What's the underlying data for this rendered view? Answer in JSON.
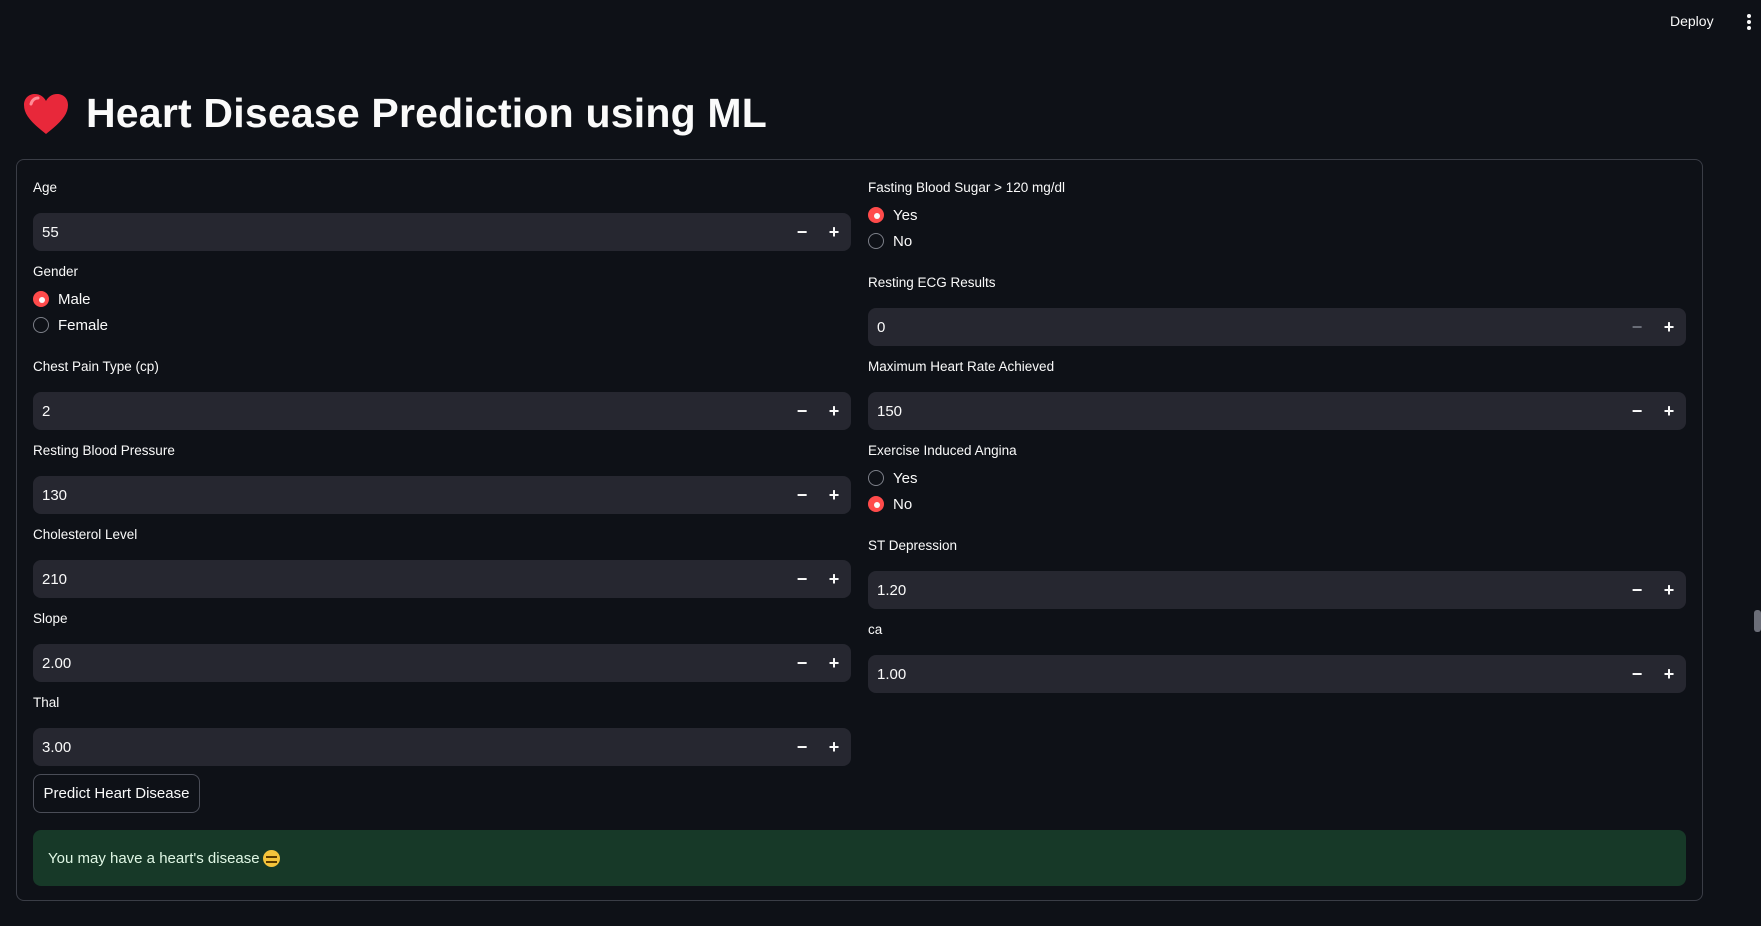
{
  "header": {
    "deploy_label": "Deploy"
  },
  "page": {
    "title": "Heart Disease Prediction using ML"
  },
  "left": {
    "age": {
      "label": "Age",
      "value": "55"
    },
    "gender": {
      "label": "Gender",
      "options": [
        "Male",
        "Female"
      ],
      "selected": "Male"
    },
    "cp": {
      "label": "Chest Pain Type (cp)",
      "value": "2"
    },
    "trestbps": {
      "label": "Resting Blood Pressure",
      "value": "130"
    },
    "chol": {
      "label": "Cholesterol Level",
      "value": "210"
    },
    "slope": {
      "label": "Slope",
      "value": "2.00"
    },
    "thal": {
      "label": "Thal",
      "value": "3.00"
    }
  },
  "right": {
    "fbs": {
      "label": "Fasting Blood Sugar > 120 mg/dl",
      "options": [
        "Yes",
        "No"
      ],
      "selected": "Yes"
    },
    "restecg": {
      "label": "Resting ECG Results",
      "value": "0"
    },
    "thalach": {
      "label": "Maximum Heart Rate Achieved",
      "value": "150"
    },
    "exang": {
      "label": "Exercise Induced Angina",
      "options": [
        "Yes",
        "No"
      ],
      "selected": "No"
    },
    "oldpeak": {
      "label": "ST Depression",
      "value": "1.20"
    },
    "ca": {
      "label": "ca",
      "value": "1.00"
    }
  },
  "stepper": {
    "minus": "−",
    "plus": "+"
  },
  "predict_button": "Predict Heart Disease",
  "result": {
    "text": "You may have a heart's disease"
  },
  "colors": {
    "accent": "#ff4b4b",
    "background": "#0e1117",
    "input": "#262730",
    "success_bg": "#173928"
  },
  "icons": [
    "heart-icon",
    "menu-icon",
    "sad-face-icon"
  ]
}
